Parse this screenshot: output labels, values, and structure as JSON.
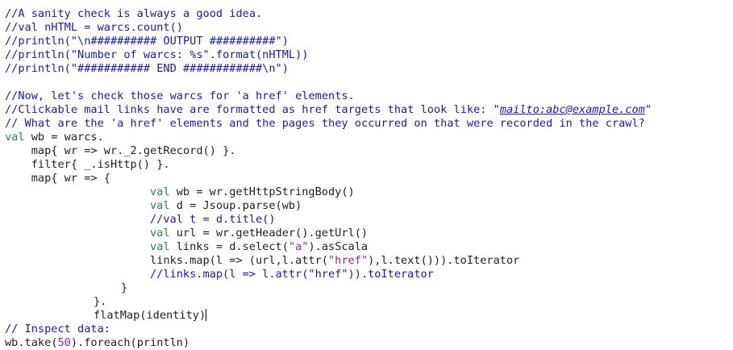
{
  "lines": {
    "l1": "//A sanity check is always a good idea.",
    "l2": "//val nHTML = warcs.count()",
    "l3": "//println(\"\\n########## OUTPUT ##########\")",
    "l4": "//println(\"Number of warcs: %s\".format(nHTML))",
    "l5": "//println(\"########### END ############\\n\")",
    "l7": "//Now, let's check those warcs for 'a href' elements.",
    "l8_pre": "//Clickable mail links have are formatted as href targets that look like: \"",
    "l8_link": "mailto:abc@example.com",
    "l8_post": "\"",
    "l9": "// What are the 'a href' elements and the pages they occurred on that were recorded in the crawl?",
    "l10_kw": "val",
    "l10_rest": " wb = warcs.",
    "l11": "    map{ wr => wr._2.getRecord() }.",
    "l12": "    filter{ _.isHttp() }.",
    "l13": "    map{ wr => {",
    "l14_kw": "val",
    "l14_rest": " wb = wr.getHttpStringBody()",
    "l15_kw": "val",
    "l15_rest": " d = Jsoup.parse(wb)",
    "l16": "//val t = d.title()",
    "l17_kw": "val",
    "l17_rest": " url = wr.getHeader().getUrl()",
    "l18_kw": "val",
    "l18_a": " links = d.select(",
    "l18_str": "\"a\"",
    "l18_b": ").asScala",
    "l19_a": "links.map(l => (url,l.attr(",
    "l19_str": "\"href\"",
    "l19_b": "),l.text())).toIterator",
    "l20": "//links.map(l => l.attr(\"href\")).toIterator",
    "l21": "}",
    "l22": "}.",
    "l23": "flatMap(identity)",
    "l24": "// Inspect data:",
    "l25_a": "wb.take(",
    "l25_num": "50",
    "l25_b": ").foreach(println)"
  }
}
